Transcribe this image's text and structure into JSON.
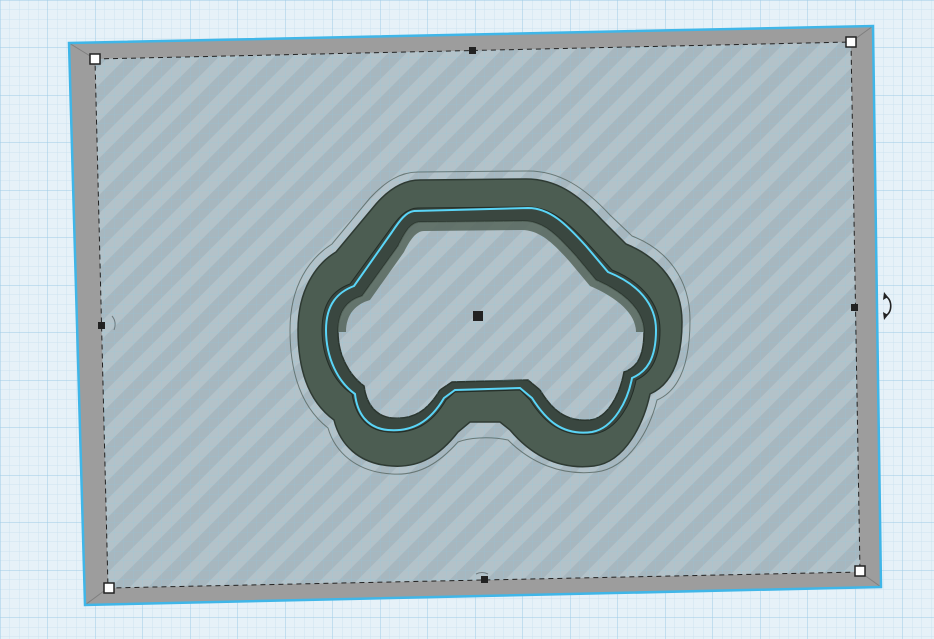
{
  "viewport": {
    "name": "3D workplane",
    "colors": {
      "grid_background": "#e6f1f8",
      "grid_minor": "#bfdcee",
      "grid_major": "#8ec3e3",
      "box_fill": "#b8c6cc",
      "box_stripe": "#a9b8bf",
      "box_bevel": "#9a9a9a",
      "selection_outline": "#43b7e6",
      "car_body": "#4e5e54",
      "car_dark": "#2f3c34",
      "car_inner": "#6a7a70",
      "car_highlight": "#58d3f5"
    },
    "selected_object": {
      "kind": "box",
      "state": "selected"
    },
    "embedded_shape": {
      "kind": "car-outline"
    },
    "handles": {
      "corner_icon": "square-handle-icon",
      "mid_icon": "dark-square-handle-icon",
      "rotate_icon": "rotate-arrow-icon"
    }
  }
}
